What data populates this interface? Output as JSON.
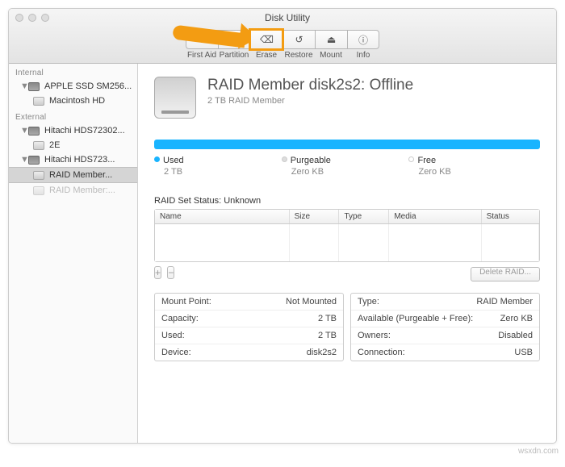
{
  "window": {
    "title": "Disk Utility"
  },
  "toolbar": {
    "items": [
      {
        "label": "First Aid",
        "glyph": "✚"
      },
      {
        "label": "Partition",
        "glyph": "◐"
      },
      {
        "label": "Erase",
        "glyph": "⌫"
      },
      {
        "label": "Restore",
        "glyph": "↺"
      },
      {
        "label": "Mount",
        "glyph": "⏏"
      },
      {
        "label": "Info",
        "glyph": "ⓘ"
      }
    ]
  },
  "sidebar": {
    "sections": {
      "internal": "Internal",
      "external": "External"
    },
    "internal": [
      {
        "label": "APPLE SSD SM256..."
      },
      {
        "label": "Macintosh HD"
      }
    ],
    "external": [
      {
        "label": "Hitachi HDS72302..."
      },
      {
        "label": "2E"
      },
      {
        "label": "Hitachi HDS723..."
      },
      {
        "label": "RAID Member..."
      },
      {
        "label": "RAID Member:..."
      }
    ]
  },
  "content": {
    "title": "RAID Member disk2s2: Offline",
    "subtitle": "2 TB RAID Member",
    "legend": {
      "used_label": "Used",
      "used_value": "2 TB",
      "purgeable_label": "Purgeable",
      "purgeable_value": "Zero KB",
      "free_label": "Free",
      "free_value": "Zero KB"
    },
    "raid_status": "RAID Set Status: Unknown",
    "table_headers": {
      "name": "Name",
      "size": "Size",
      "type": "Type",
      "media": "Media",
      "status": "Status"
    },
    "buttons": {
      "add": "+",
      "remove": "−",
      "delete": "Delete RAID..."
    },
    "info_left": [
      {
        "k": "Mount Point:",
        "v": "Not Mounted"
      },
      {
        "k": "Capacity:",
        "v": "2 TB"
      },
      {
        "k": "Used:",
        "v": "2 TB"
      },
      {
        "k": "Device:",
        "v": "disk2s2"
      }
    ],
    "info_right": [
      {
        "k": "Type:",
        "v": "RAID Member"
      },
      {
        "k": "Available (Purgeable + Free):",
        "v": "Zero KB"
      },
      {
        "k": "Owners:",
        "v": "Disabled"
      },
      {
        "k": "Connection:",
        "v": "USB"
      }
    ]
  },
  "watermark": "wsxdn.com"
}
